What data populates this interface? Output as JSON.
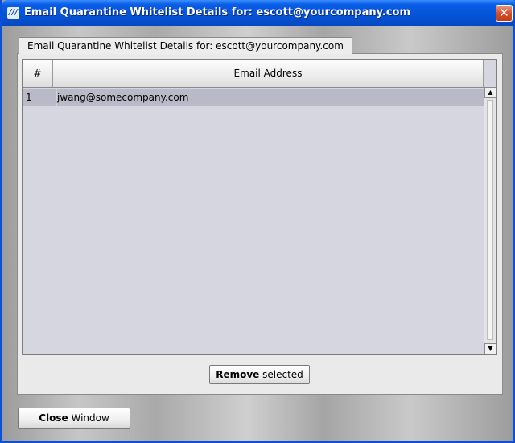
{
  "window": {
    "title": "Email Quarantine Whitelist Details for: escott@yourcompany.com",
    "logo_glyph": "///",
    "close_glyph": "✕"
  },
  "tab": {
    "label": "Email Quarantine Whitelist Details for: escott@yourcompany.com"
  },
  "table": {
    "columns": [
      "#",
      "Email Address"
    ],
    "rows": [
      {
        "num": "1",
        "email": "jwang@somecompany.com"
      }
    ]
  },
  "buttons": {
    "remove_bold": "Remove",
    "remove_rest": " selected",
    "close_bold": "Close",
    "close_rest": " Window"
  },
  "scrollbar": {
    "up_glyph": "▲",
    "down_glyph": "▼"
  }
}
